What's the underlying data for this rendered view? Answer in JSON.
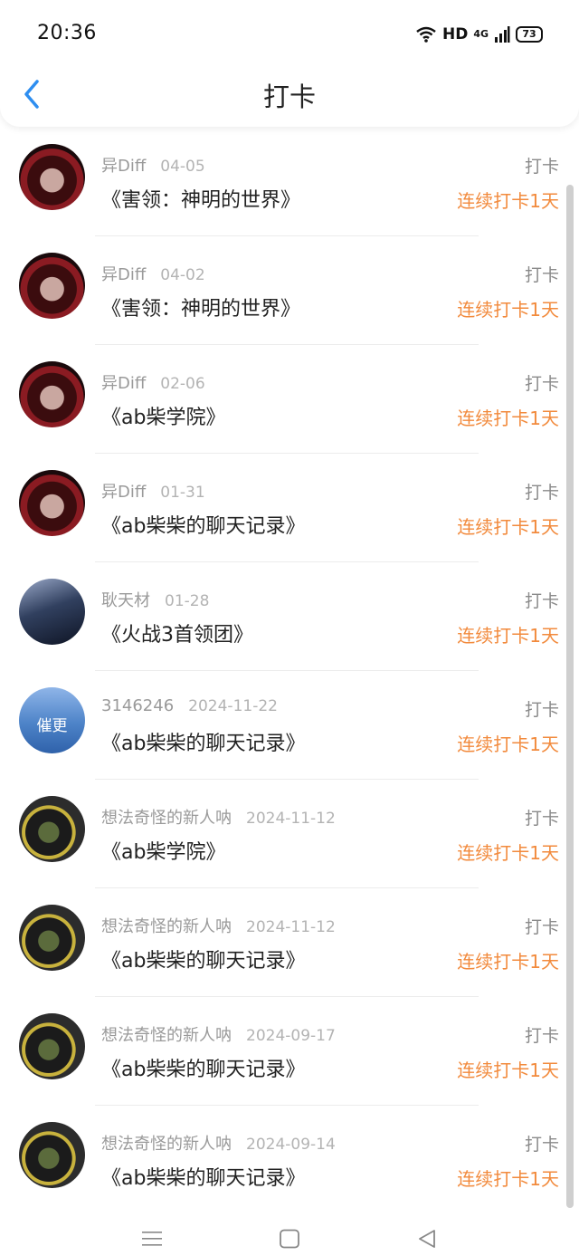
{
  "status_bar": {
    "time": "20:36",
    "hd_label": "HD",
    "network_label": "4G",
    "battery_level": "73"
  },
  "header": {
    "title": "打卡"
  },
  "items": [
    {
      "user": "异Diff",
      "date": "04-05",
      "book": "《害领：神明的世界》",
      "kind": "打卡",
      "streak": "连续打卡1天",
      "avatar": "dark"
    },
    {
      "user": "异Diff",
      "date": "04-02",
      "book": "《害领：神明的世界》",
      "kind": "打卡",
      "streak": "连续打卡1天",
      "avatar": "dark"
    },
    {
      "user": "异Diff",
      "date": "02-06",
      "book": "《ab柴学院》",
      "kind": "打卡",
      "streak": "连续打卡1天",
      "avatar": "dark"
    },
    {
      "user": "异Diff",
      "date": "01-31",
      "book": "《ab柴柴的聊天记录》",
      "kind": "打卡",
      "streak": "连续打卡1天",
      "avatar": "dark"
    },
    {
      "user": "耿天材",
      "date": "01-28",
      "book": "《火战3首领团》",
      "kind": "打卡",
      "streak": "连续打卡1天",
      "avatar": "boy"
    },
    {
      "user": "3146246",
      "date": "2024-11-22",
      "book": "《ab柴柴的聊天记录》",
      "kind": "打卡",
      "streak": "连续打卡1天",
      "avatar": "blue",
      "avatar_text": "催更"
    },
    {
      "user": "想法奇怪的新人呐",
      "date": "2024-11-12",
      "book": "《ab柴学院》",
      "kind": "打卡",
      "streak": "连续打卡1天",
      "avatar": "group"
    },
    {
      "user": "想法奇怪的新人呐",
      "date": "2024-11-12",
      "book": "《ab柴柴的聊天记录》",
      "kind": "打卡",
      "streak": "连续打卡1天",
      "avatar": "group"
    },
    {
      "user": "想法奇怪的新人呐",
      "date": "2024-09-17",
      "book": "《ab柴柴的聊天记录》",
      "kind": "打卡",
      "streak": "连续打卡1天",
      "avatar": "group"
    },
    {
      "user": "想法奇怪的新人呐",
      "date": "2024-09-14",
      "book": "《ab柴柴的聊天记录》",
      "kind": "打卡",
      "streak": "连续打卡1天",
      "avatar": "group"
    }
  ],
  "colors": {
    "accent_blue": "#2e8ef0",
    "streak_orange": "#f28a3c"
  }
}
